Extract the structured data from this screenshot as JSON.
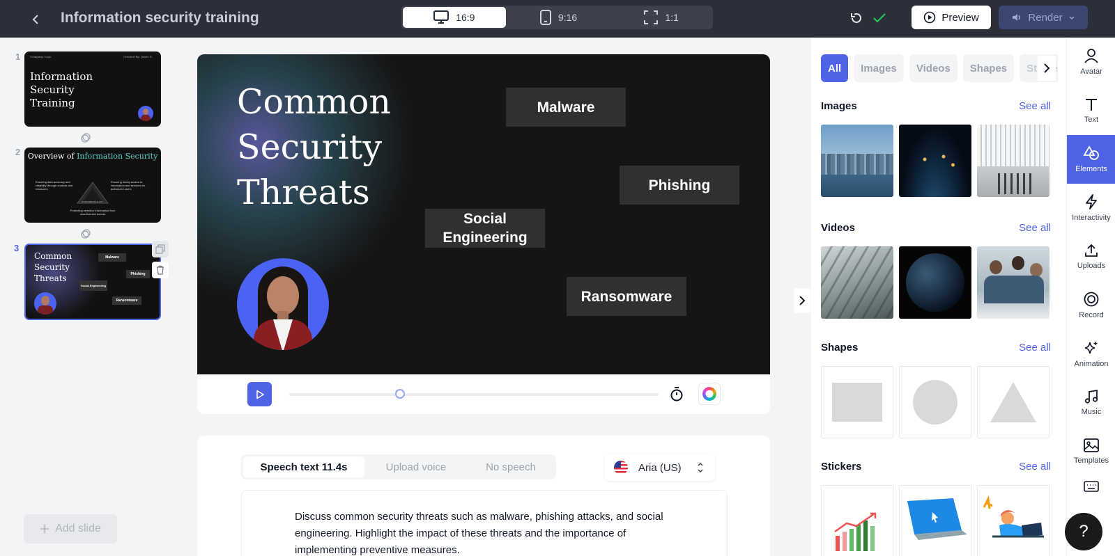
{
  "header": {
    "title": "Information security training",
    "ratios": [
      {
        "label": "16:9",
        "icon": "monitor-icon",
        "active": true
      },
      {
        "label": "9:16",
        "icon": "phone-icon",
        "active": false
      },
      {
        "label": "1:1",
        "icon": "square-frame-icon",
        "active": false
      }
    ],
    "preview_label": "Preview",
    "render_label": "Render"
  },
  "slides": [
    {
      "number": "1",
      "title": "Information Security Training",
      "logo": "Company Logo",
      "credit": "Created By: Jones D."
    },
    {
      "number": "2",
      "title_a": "Overview of ",
      "title_b": "Information Security",
      "left_text": "Ensuring data accuracy and reliability through controls and measures",
      "right_text": "Ensuring timely access to information and services for authorized users",
      "bottom_text": "Protecting sensitive information from unauthorized access",
      "center_label": "CONFIDENTIALITY"
    },
    {
      "number": "3",
      "title": "Common Security Threats",
      "tags": [
        "Malware",
        "Phishing",
        "Social Engineering",
        "Ransomware"
      ]
    }
  ],
  "add_slide_label": "Add slide",
  "canvas": {
    "title": "Common\nSecurity\nThreats",
    "tags": {
      "malware": "Malware",
      "phishing": "Phishing",
      "social": "Social\nEngineering",
      "ransomware": "Ransomware"
    }
  },
  "playback": {
    "progress": 0.3,
    "accent": "#4f63e6"
  },
  "speech": {
    "tabs": [
      "Speech text 11.4s",
      "Upload voice",
      "No speech"
    ],
    "active_tab": 0,
    "voice": "Aria (US)",
    "text": "Discuss common security threats such as malware, phishing attacks, and social engineering. Highlight the impact of these threats and the importance of implementing preventive measures."
  },
  "library": {
    "filters": [
      "All",
      "Images",
      "Videos",
      "Shapes",
      "Stickers"
    ],
    "active_filter": 0,
    "sections": {
      "images": {
        "title": "Images",
        "see_all": "See all"
      },
      "videos": {
        "title": "Videos",
        "see_all": "See all"
      },
      "shapes": {
        "title": "Shapes",
        "see_all": "See all"
      },
      "stickers": {
        "title": "Stickers",
        "see_all": "See all"
      }
    }
  },
  "toolbar": [
    {
      "label": "Avatar",
      "icon": "person-icon"
    },
    {
      "label": "Text",
      "icon": "text-icon"
    },
    {
      "label": "Elements",
      "icon": "shapes-icon",
      "active": true
    },
    {
      "label": "Interactivity",
      "icon": "bolt-icon"
    },
    {
      "label": "Uploads",
      "icon": "upload-icon"
    },
    {
      "label": "Record",
      "icon": "record-icon"
    },
    {
      "label": "Animation",
      "icon": "sparkle-icon"
    },
    {
      "label": "Music",
      "icon": "music-icon"
    },
    {
      "label": "Templates",
      "icon": "image-icon"
    },
    {
      "label": "",
      "icon": "keyboard-icon"
    }
  ],
  "help_label": "?"
}
